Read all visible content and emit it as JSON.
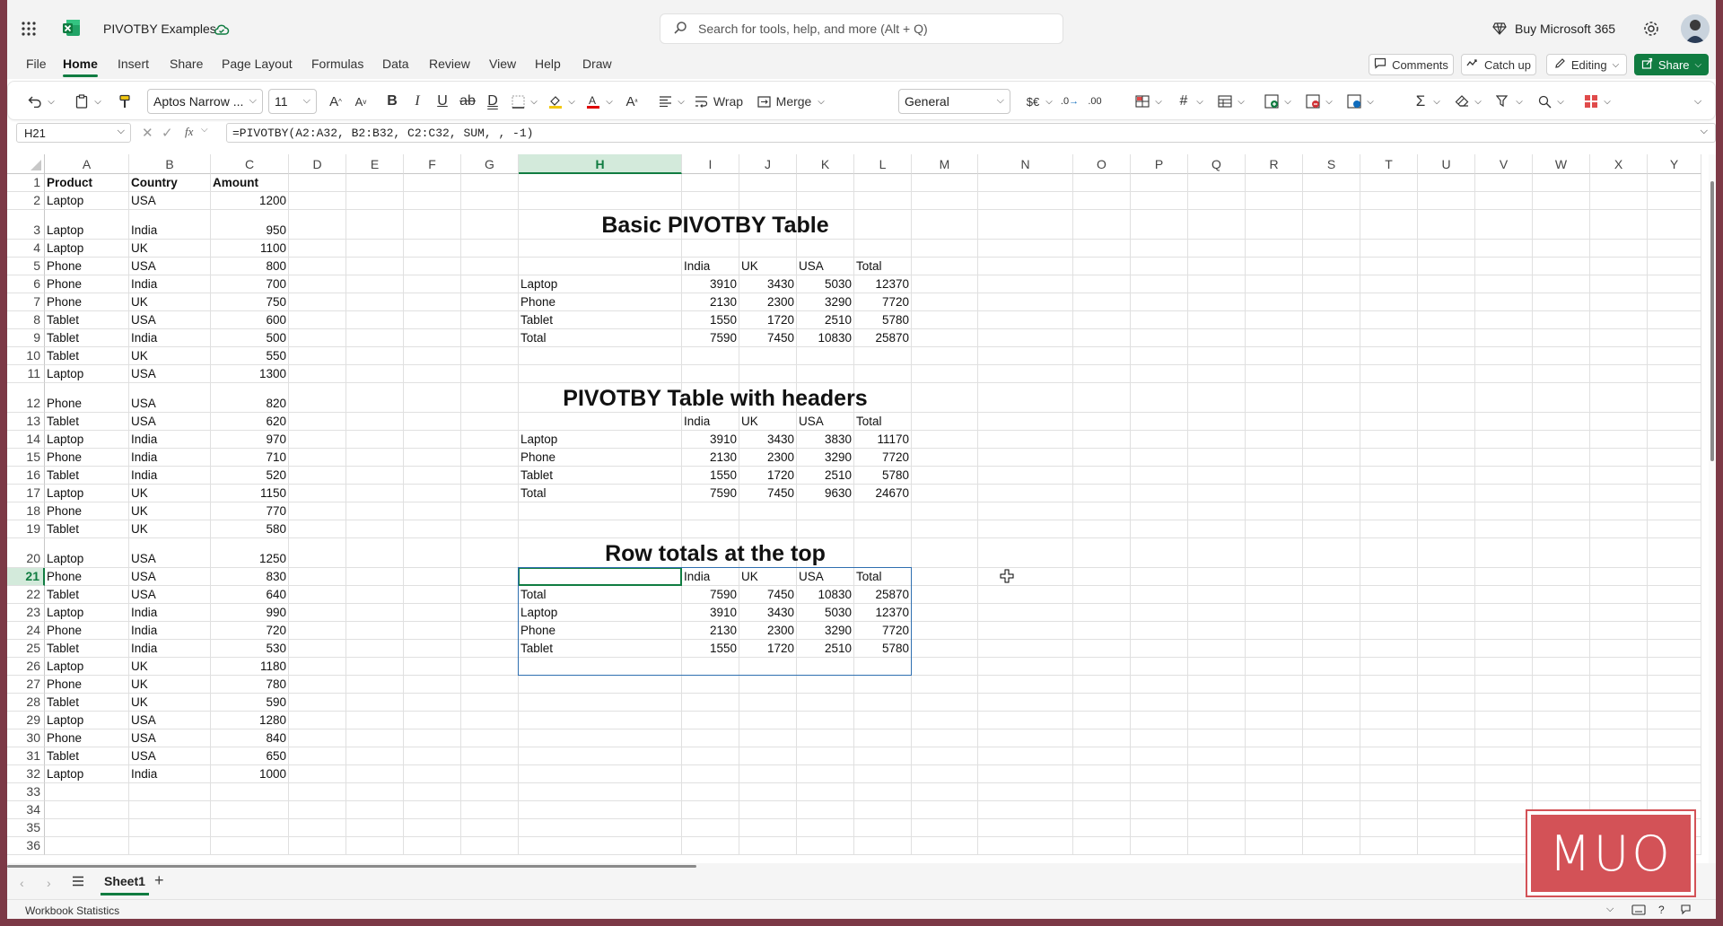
{
  "titlebar": {
    "file_name": "PIVOTBY Examples",
    "search_placeholder": "Search for tools, help, and more (Alt + Q)",
    "buy_label": "Buy Microsoft 365"
  },
  "menu": {
    "tabs": [
      "File",
      "Home",
      "Insert",
      "Share",
      "Page Layout",
      "Formulas",
      "Data",
      "Review",
      "View",
      "Help",
      "Draw"
    ],
    "active_tab": "Home",
    "comments_label": "Comments",
    "catchup_label": "Catch up",
    "editing_label": "Editing",
    "share_label": "Share"
  },
  "ribbon": {
    "font_name": "Aptos Narrow ...",
    "font_size": "11",
    "wrap_label": "Wrap",
    "merge_label": "Merge",
    "number_format": "General"
  },
  "formula_bar": {
    "name_box": "H21",
    "formula": "=PIVOTBY(A2:A32, B2:B32, C2:C32, SUM, , -1)"
  },
  "columns": [
    "A",
    "B",
    "C",
    "D",
    "E",
    "F",
    "G",
    "H",
    "I",
    "J",
    "K",
    "L",
    "M",
    "N",
    "O",
    "P",
    "Q",
    "R",
    "S",
    "T",
    "U",
    "V",
    "W",
    "X",
    "Y"
  ],
  "selected_column": "H",
  "selected_row": "21",
  "source": {
    "headers": [
      "Product",
      "Country",
      "Amount"
    ],
    "rows": [
      [
        "Laptop",
        "USA",
        "1200"
      ],
      [
        "Laptop",
        "India",
        "950"
      ],
      [
        "Laptop",
        "UK",
        "1100"
      ],
      [
        "Phone",
        "USA",
        "800"
      ],
      [
        "Phone",
        "India",
        "700"
      ],
      [
        "Phone",
        "UK",
        "750"
      ],
      [
        "Tablet",
        "USA",
        "600"
      ],
      [
        "Tablet",
        "India",
        "500"
      ],
      [
        "Tablet",
        "UK",
        "550"
      ],
      [
        "Laptop",
        "USA",
        "1300"
      ],
      [
        "Phone",
        "USA",
        "820"
      ],
      [
        "Tablet",
        "USA",
        "620"
      ],
      [
        "Laptop",
        "India",
        "970"
      ],
      [
        "Phone",
        "India",
        "710"
      ],
      [
        "Tablet",
        "India",
        "520"
      ],
      [
        "Laptop",
        "UK",
        "1150"
      ],
      [
        "Phone",
        "UK",
        "770"
      ],
      [
        "Tablet",
        "UK",
        "580"
      ],
      [
        "Laptop",
        "USA",
        "1250"
      ],
      [
        "Phone",
        "USA",
        "830"
      ],
      [
        "Tablet",
        "USA",
        "640"
      ],
      [
        "Laptop",
        "India",
        "990"
      ],
      [
        "Phone",
        "India",
        "720"
      ],
      [
        "Tablet",
        "India",
        "530"
      ],
      [
        "Laptop",
        "UK",
        "1180"
      ],
      [
        "Phone",
        "UK",
        "780"
      ],
      [
        "Tablet",
        "UK",
        "590"
      ],
      [
        "Laptop",
        "USA",
        "1280"
      ],
      [
        "Phone",
        "USA",
        "840"
      ],
      [
        "Tablet",
        "USA",
        "650"
      ],
      [
        "Laptop",
        "India",
        "1000"
      ]
    ]
  },
  "pivot_tables": [
    {
      "title": "Basic PIVOTBY Table",
      "col_headers": [
        "India",
        "UK",
        "USA",
        "Total"
      ],
      "rows": [
        [
          "Laptop",
          "3910",
          "3430",
          "5030",
          "12370"
        ],
        [
          "Phone",
          "2130",
          "2300",
          "3290",
          "7720"
        ],
        [
          "Tablet",
          "1550",
          "1720",
          "2510",
          "5780"
        ],
        [
          "Total",
          "7590",
          "7450",
          "10830",
          "25870"
        ]
      ]
    },
    {
      "title": "PIVOTBY Table with headers",
      "col_headers": [
        "India",
        "UK",
        "USA",
        "Total"
      ],
      "rows": [
        [
          "Laptop",
          "3910",
          "3430",
          "3830",
          "11170"
        ],
        [
          "Phone",
          "2130",
          "2300",
          "3290",
          "7720"
        ],
        [
          "Tablet",
          "1550",
          "1720",
          "2510",
          "5780"
        ],
        [
          "Total",
          "7590",
          "7450",
          "9630",
          "24670"
        ]
      ]
    },
    {
      "title": "Row totals at the top",
      "col_headers": [
        "India",
        "UK",
        "USA",
        "Total"
      ],
      "rows": [
        [
          "Total",
          "7590",
          "7450",
          "10830",
          "25870"
        ],
        [
          "Laptop",
          "3910",
          "3430",
          "5030",
          "12370"
        ],
        [
          "Phone",
          "2130",
          "2300",
          "3290",
          "7720"
        ],
        [
          "Tablet",
          "1550",
          "1720",
          "2510",
          "5780"
        ]
      ]
    }
  ],
  "sheet_tabs": [
    "Sheet1"
  ],
  "status_bar": {
    "left_text": "Workbook Statistics"
  },
  "watermark": "MUO",
  "colors": {
    "accent": "#107c41",
    "frame": "#7c3946",
    "watermark": "#d35257"
  }
}
